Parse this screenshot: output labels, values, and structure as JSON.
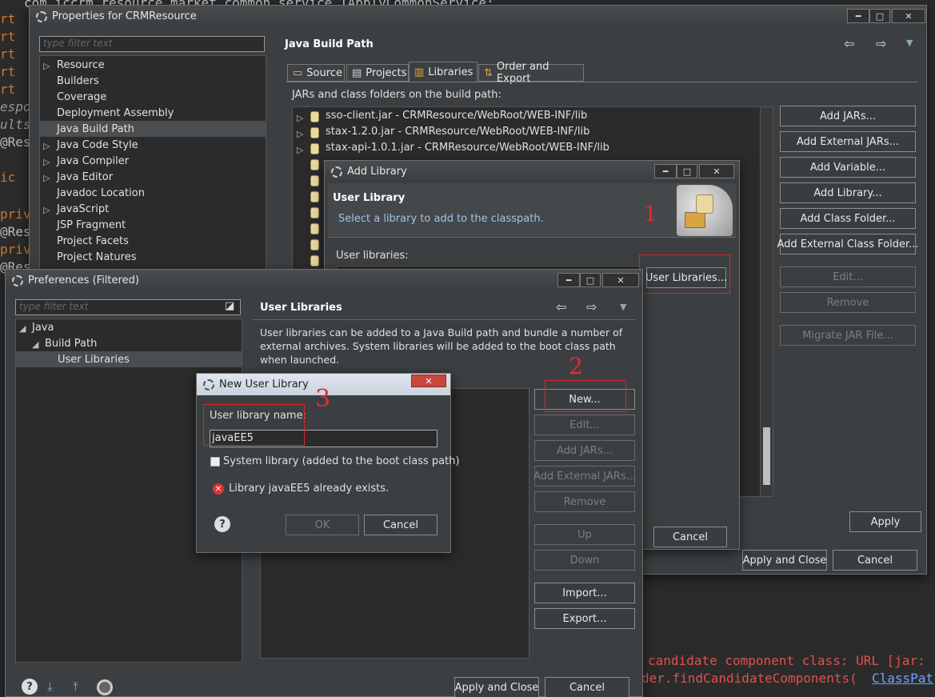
{
  "editor": {
    "top_line": "com.iccrm.resource.market.common.service.IApplyCommonService;",
    "fragments": [
      "rt",
      "rt",
      "rt",
      "rt",
      "rt",
      "espo",
      "ults",
      "@Res",
      "ic",
      "priv",
      "@Res",
      "priv",
      "@Res"
    ],
    "console_1": "candidate component class: URL [jar:",
    "console_2": "der.findCandidateComponents(",
    "console_link": "ClassPat"
  },
  "properties": {
    "title": "Properties for CRMResource",
    "filter_placeholder": "type filter text",
    "tree": [
      "Resource",
      "Builders",
      "Coverage",
      "Deployment Assembly",
      "Java Build Path",
      "Java Code Style",
      "Java Compiler",
      "Java Editor",
      "Javadoc Location",
      "JavaScript",
      "JSP Fragment",
      "Project Facets",
      "Project Natures"
    ],
    "page_title": "Java Build Path",
    "tabs": [
      "Source",
      "Projects",
      "Libraries",
      "Order and Export"
    ],
    "list_label": "JARs and class folders on the build path:",
    "jars": [
      "sso-client.jar - CRMResource/WebRoot/WEB-INF/lib",
      "stax-1.2.0.jar - CRMResource/WebRoot/WEB-INF/lib",
      "stax-api-1.0.1.jar - CRMResource/WebRoot/WEB-INF/lib"
    ],
    "buttons": [
      "Add JARs...",
      "Add External JARs...",
      "Add Variable...",
      "Add Library...",
      "Add Class Folder...",
      "Add External Class Folder..."
    ],
    "disabled_buttons": [
      "Edit...",
      "Remove",
      "Migrate JAR File..."
    ],
    "apply": "Apply",
    "apply_close": "Apply and Close",
    "cancel": "Cancel"
  },
  "add_library": {
    "title": "Add Library",
    "heading": "User Library",
    "subtitle": "Select a library to add to the classpath.",
    "user_libraries_label": "User libraries:",
    "user_libraries_button": "User Libraries...",
    "cancel": "Cancel",
    "annotation": "1"
  },
  "preferences": {
    "title": "Preferences (Filtered)",
    "filter_placeholder": "type filter text",
    "tree": [
      "Java",
      "Build Path",
      "User Libraries"
    ],
    "page_title": "User Libraries",
    "description": "User libraries can be added to a Java Build path and bundle a number of external archives. System libraries will be added to the boot class path when launched.",
    "buttons": [
      "New...",
      "Edit...",
      "Add JARs...",
      "Add External JARs...",
      "Remove",
      "Up",
      "Down",
      "Import...",
      "Export..."
    ],
    "apply_close": "Apply and Close",
    "cancel": "Cancel",
    "annotation": "2"
  },
  "new_library": {
    "title": "New User Library",
    "name_label": "User library name:",
    "name_value": "javaEE5",
    "system_checkbox": "System library (added to the boot class path)",
    "error": "Library javaEE5 already exists.",
    "ok": "OK",
    "cancel": "Cancel",
    "annotation": "3"
  }
}
